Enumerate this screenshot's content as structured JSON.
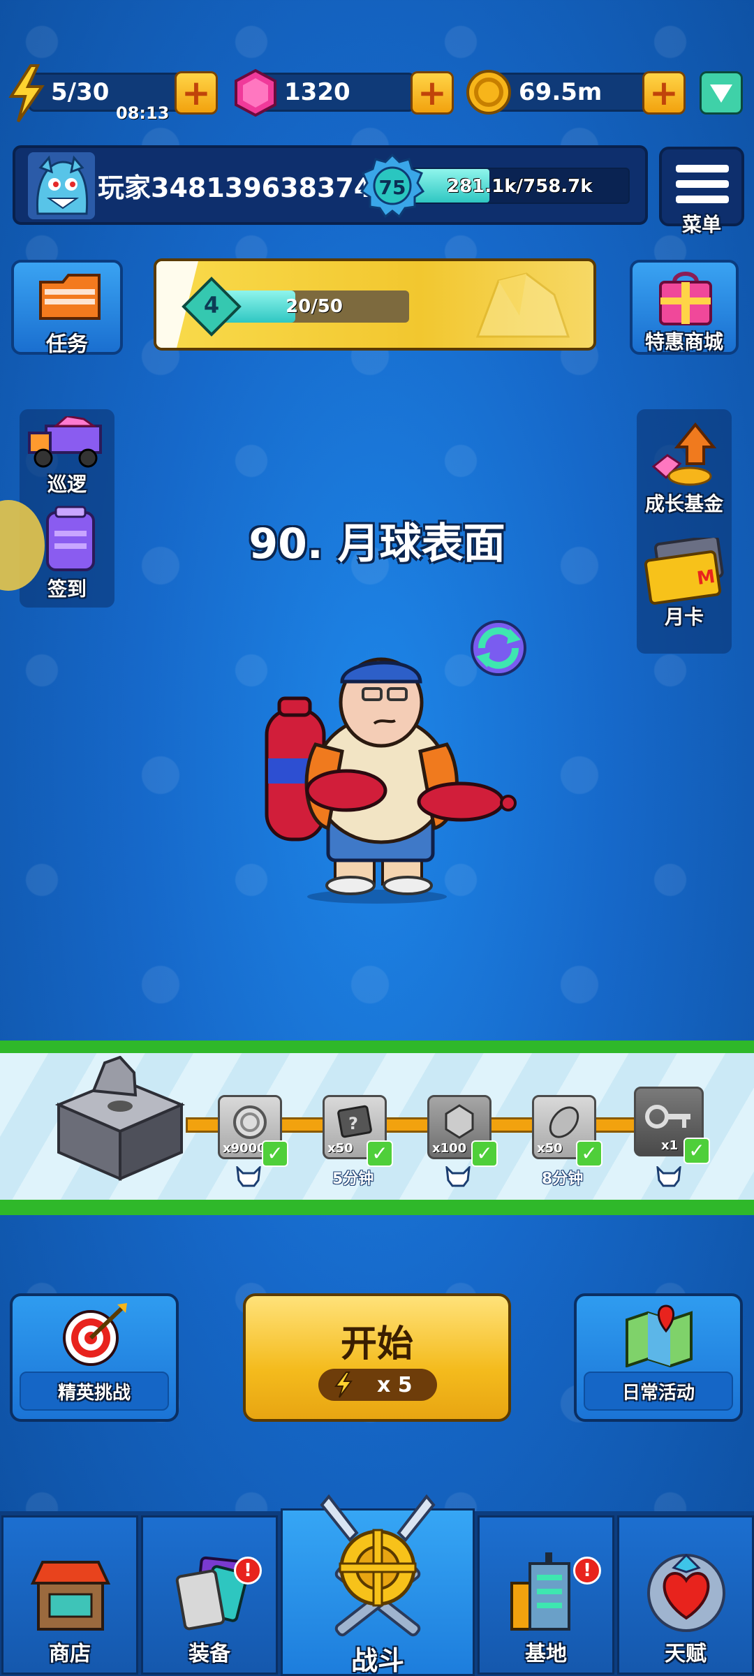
{
  "resources": {
    "energy": "5/30",
    "energy_timer": "08:13",
    "gems": "1320",
    "coins": "69.5m"
  },
  "profile": {
    "player_name": "玩家3481396383747",
    "level": "75",
    "xp": "281.1k/758.7k",
    "xp_fraction": 0.37
  },
  "menu": {
    "label": "菜单"
  },
  "top_panel": {
    "tasks_label": "任务",
    "pass_level": "4",
    "pass_progress": "20/50",
    "pass_fraction": 0.4,
    "shop_label": "特惠商城"
  },
  "left_side": {
    "patrol_label": "巡逻",
    "signin_label": "签到"
  },
  "right_side": {
    "growth_fund_label": "成长基金",
    "monthly_card_label": "月卡"
  },
  "stage": {
    "title": "90. 月球表面"
  },
  "rewards": [
    {
      "qty": "x9000",
      "note": ""
    },
    {
      "qty": "x50",
      "note": "5分钟"
    },
    {
      "qty": "x100",
      "note": ""
    },
    {
      "qty": "x50",
      "note": "8分钟"
    },
    {
      "qty": "x1",
      "note": ""
    }
  ],
  "actions": {
    "elite_label": "精英挑战",
    "start_label": "开始",
    "start_cost": "x 5",
    "daily_label": "日常活动"
  },
  "nav": {
    "shop": "商店",
    "equipment": "装备",
    "battle": "战斗",
    "base": "基地",
    "talent": "天赋"
  },
  "colors": {
    "accent_yellow": "#f4bb1d",
    "badge_red": "#e8231d",
    "progress_teal": "#35d6d0",
    "strip_green": "#2fb82a"
  }
}
